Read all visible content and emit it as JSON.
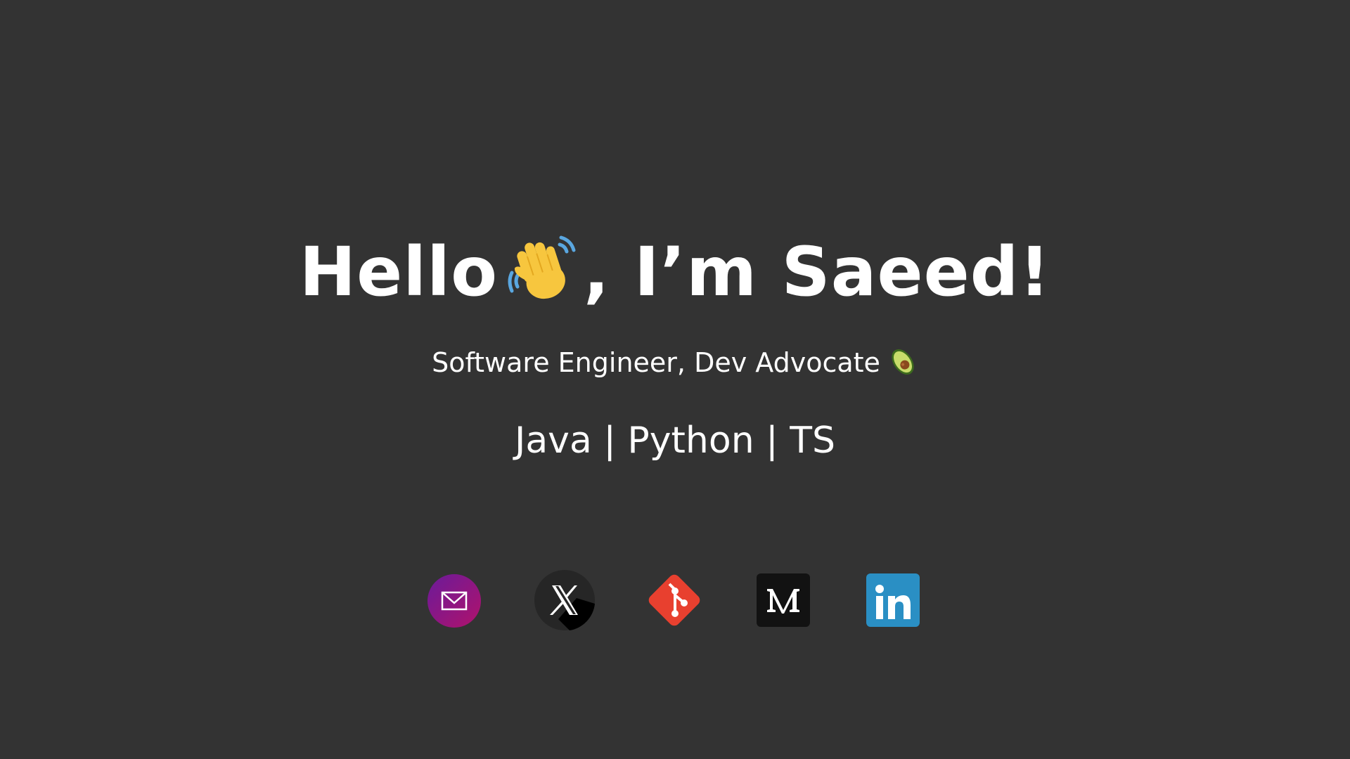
{
  "hero": {
    "greeting": "Hello",
    "wave_icon": "waving-hand-emoji",
    "intro": ", I’m Saeed!"
  },
  "subtitle": {
    "text": "Software Engineer, Dev Advocate",
    "icon": "avocado-emoji"
  },
  "languages": "Java | Python | TS",
  "socials": [
    {
      "icon": "email-icon",
      "color": "#8e1a8a"
    },
    {
      "icon": "x-icon",
      "color": "#222222"
    },
    {
      "icon": "git-icon",
      "color": "#e8402f"
    },
    {
      "icon": "medium-icon",
      "color": "#121212"
    },
    {
      "icon": "linkedin-icon",
      "color": "#2a8fc4"
    }
  ],
  "colors": {
    "background": "#333333",
    "text": "#ffffff"
  }
}
